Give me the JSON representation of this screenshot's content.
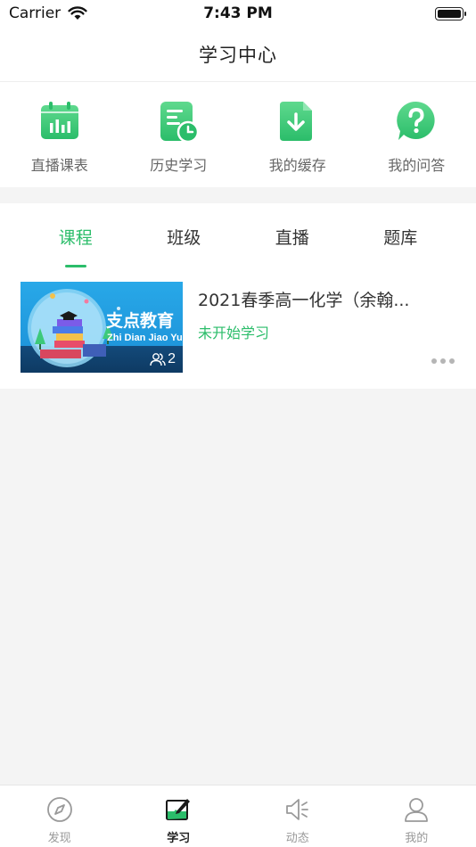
{
  "status_bar": {
    "carrier": "Carrier",
    "time": "7:43 PM"
  },
  "nav": {
    "title": "学习中心"
  },
  "quick_actions": [
    {
      "label": "直播课表",
      "icon": "calendar-chart-icon"
    },
    {
      "label": "历史学习",
      "icon": "history-doc-icon"
    },
    {
      "label": "我的缓存",
      "icon": "download-folder-icon"
    },
    {
      "label": "我的问答",
      "icon": "question-bubble-icon"
    }
  ],
  "tabs": [
    {
      "label": "课程",
      "active": true
    },
    {
      "label": "班级",
      "active": false
    },
    {
      "label": "直播",
      "active": false
    },
    {
      "label": "题库",
      "active": false
    }
  ],
  "course": {
    "title": "2021春季高一化学（余翰...",
    "status": "未开始学习",
    "student_count": "2",
    "thumb_brand": "支点教育",
    "thumb_sub": "Zhi Dian Jiao Yu"
  },
  "tab_bar": [
    {
      "label": "发现",
      "icon": "compass-icon",
      "active": false
    },
    {
      "label": "学习",
      "icon": "study-board-icon",
      "active": true
    },
    {
      "label": "动态",
      "icon": "speaker-icon",
      "active": false
    },
    {
      "label": "我的",
      "icon": "person-icon",
      "active": false
    }
  ],
  "colors": {
    "accent": "#2bbd6a",
    "icon_green": "#3cc97a"
  }
}
